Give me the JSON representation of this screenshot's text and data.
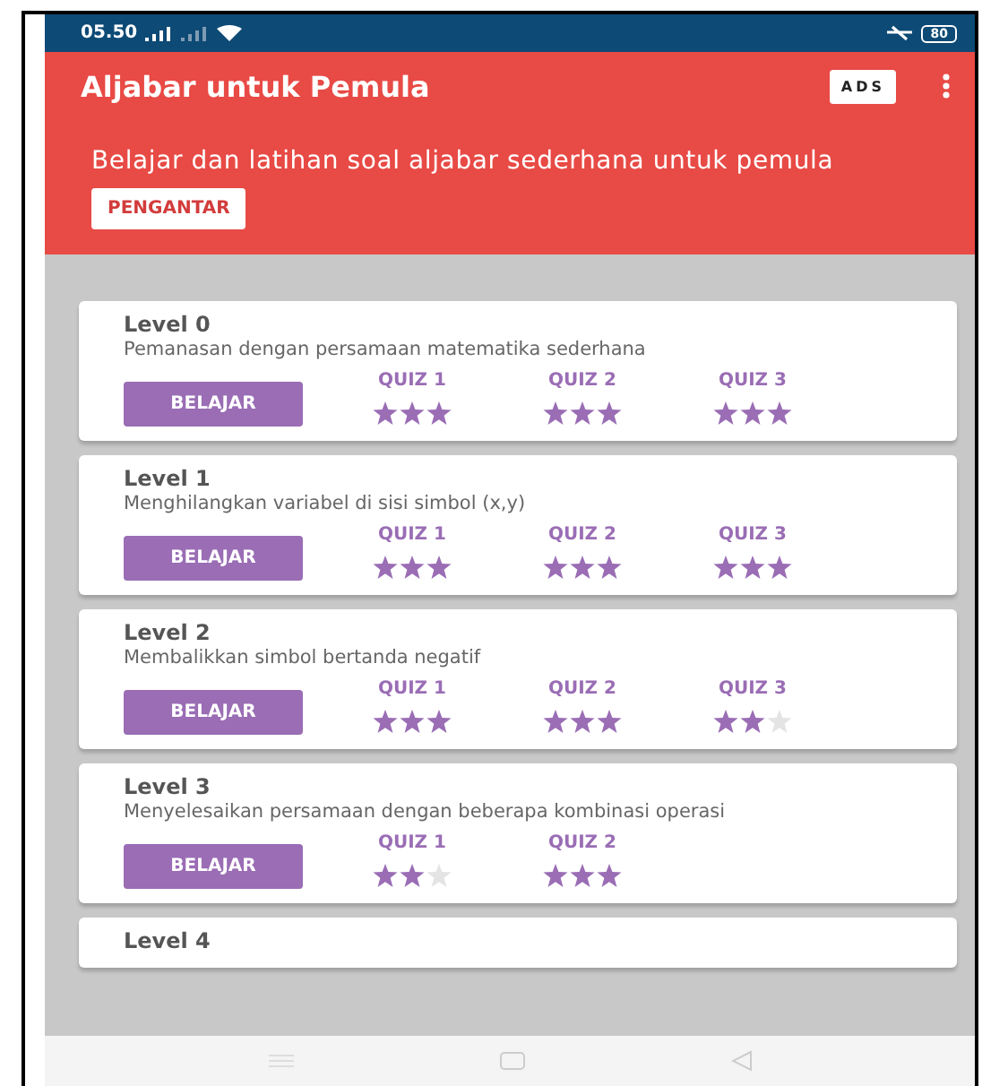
{
  "status_bar": {
    "time": "05.50",
    "battery": "80"
  },
  "app_bar": {
    "title": "Aljabar untuk Pemula",
    "ads_label": "ADS"
  },
  "header": {
    "text": "Belajar dan latihan soal aljabar sederhana untuk pemula",
    "button": "PENGANTAR"
  },
  "levels": [
    {
      "title": "Level 0",
      "description": "Pemanasan dengan persamaan matematika sederhana",
      "button": "BELAJAR",
      "quizzes": [
        {
          "label": "QUIZ 1",
          "stars": 3
        },
        {
          "label": "QUIZ 2",
          "stars": 3
        },
        {
          "label": "QUIZ 3",
          "stars": 3
        }
      ]
    },
    {
      "title": "Level 1",
      "description": "Menghilangkan variabel di sisi simbol (x,y)",
      "button": "BELAJAR",
      "quizzes": [
        {
          "label": "QUIZ 1",
          "stars": 3
        },
        {
          "label": "QUIZ 2",
          "stars": 3
        },
        {
          "label": "QUIZ 3",
          "stars": 3
        }
      ]
    },
    {
      "title": "Level 2",
      "description": "Membalikkan simbol bertanda negatif",
      "button": "BELAJAR",
      "quizzes": [
        {
          "label": "QUIZ 1",
          "stars": 3
        },
        {
          "label": "QUIZ 2",
          "stars": 3
        },
        {
          "label": "QUIZ 3",
          "stars": 2
        }
      ]
    },
    {
      "title": "Level 3",
      "description": "Menyelesaikan persamaan dengan beberapa kombinasi operasi",
      "button": "BELAJAR",
      "quizzes": [
        {
          "label": "QUIZ 1",
          "stars": 2
        },
        {
          "label": "QUIZ 2",
          "stars": 3
        }
      ]
    },
    {
      "title": "Level 4"
    }
  ]
}
